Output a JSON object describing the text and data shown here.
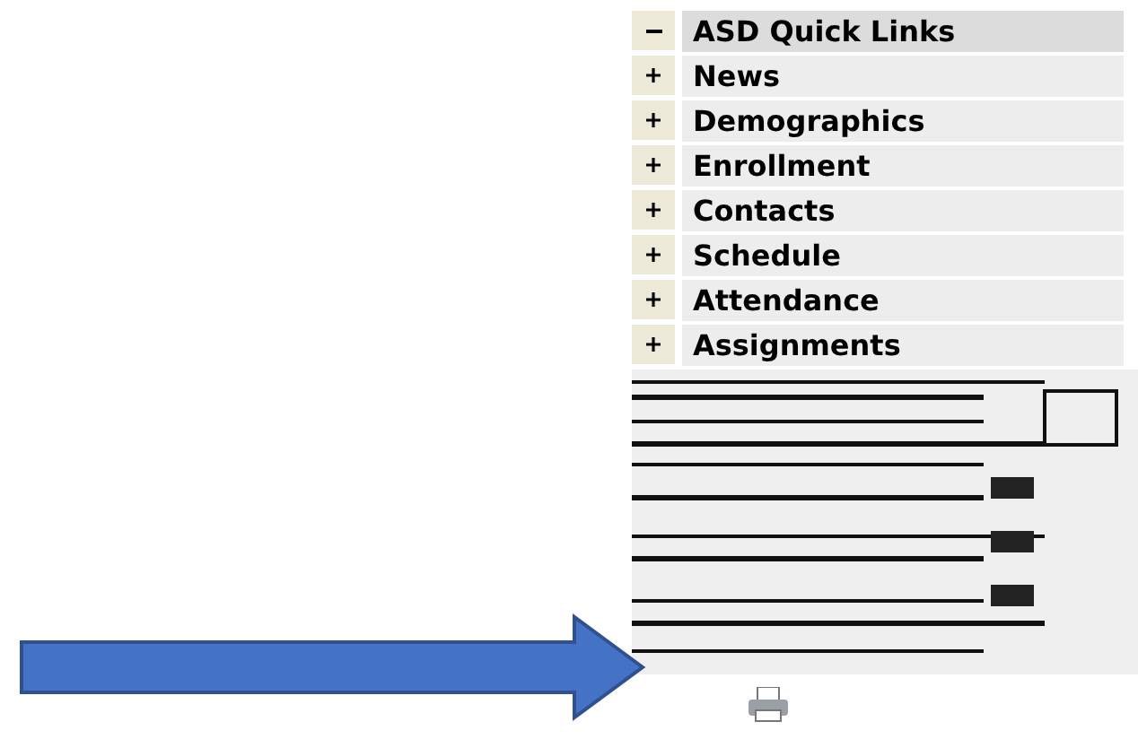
{
  "menu": {
    "items": [
      {
        "label": "ASD Quick Links",
        "expanded": true
      },
      {
        "label": "News",
        "expanded": false
      },
      {
        "label": "Demographics",
        "expanded": false
      },
      {
        "label": "Enrollment",
        "expanded": false
      },
      {
        "label": "Contacts",
        "expanded": false
      },
      {
        "label": "Schedule",
        "expanded": false
      },
      {
        "label": "Attendance",
        "expanded": false
      },
      {
        "label": "Assignments",
        "expanded": false
      }
    ]
  }
}
